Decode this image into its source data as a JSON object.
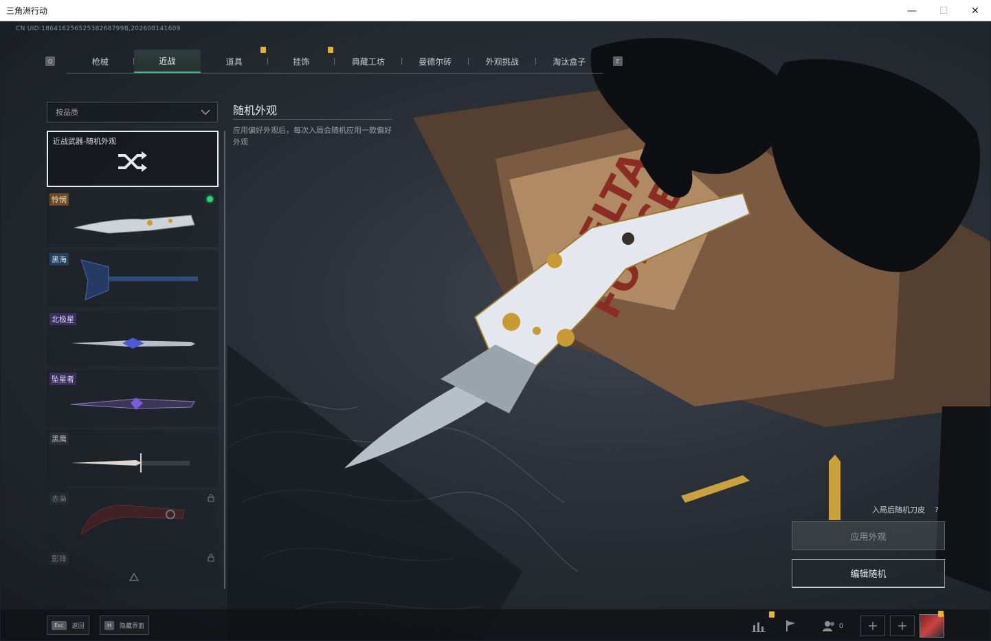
{
  "window": {
    "title": "三角洲行动",
    "minimize": "—",
    "maximize": "☐",
    "close": "✕"
  },
  "uid": "CN UID:18641625652538268799B,202608141609",
  "tabs": {
    "prev_key": "Q",
    "next_key": "E",
    "items": [
      {
        "label": "枪械",
        "active": false,
        "badge": false
      },
      {
        "label": "近战",
        "active": true,
        "badge": false
      },
      {
        "label": "道具",
        "active": false,
        "badge": true
      },
      {
        "label": "挂饰",
        "active": false,
        "badge": true
      },
      {
        "label": "典藏工坊",
        "active": false,
        "badge": false
      },
      {
        "label": "曼德尔砖",
        "active": false,
        "badge": false
      },
      {
        "label": "外观挑战",
        "active": false,
        "badge": false
      },
      {
        "label": "淘汰盒子",
        "active": false,
        "badge": false
      }
    ]
  },
  "sort": {
    "label": "按品质"
  },
  "list": {
    "items": [
      {
        "name": "近战武器-随机外观",
        "quality": "none",
        "selected": true,
        "equipped": false,
        "locked": false,
        "icon": "shuffle-icon"
      },
      {
        "name": "怜悯",
        "quality": "orange",
        "selected": false,
        "equipped": true,
        "locked": false,
        "icon": "butterfly-knife-icon"
      },
      {
        "name": "黑海",
        "quality": "blue",
        "selected": false,
        "equipped": false,
        "locked": false,
        "icon": "tomahawk-icon"
      },
      {
        "name": "北极星",
        "quality": "purple",
        "selected": false,
        "equipped": false,
        "locked": false,
        "icon": "dagger-icon"
      },
      {
        "name": "坠星者",
        "quality": "purple",
        "selected": false,
        "equipped": false,
        "locked": false,
        "icon": "blade-icon"
      },
      {
        "name": "黑鹰",
        "quality": "gray",
        "selected": false,
        "equipped": false,
        "locked": false,
        "icon": "combat-knife-icon"
      },
      {
        "name": "赤枭",
        "quality": "gray",
        "selected": false,
        "equipped": false,
        "locked": true,
        "icon": "karambit-icon"
      },
      {
        "name": "影锋",
        "quality": "gray",
        "selected": false,
        "equipped": false,
        "locked": true,
        "icon": "blade-icon"
      }
    ]
  },
  "info": {
    "title": "随机外观",
    "description": "应用偏好外观后，每次入局会随机应用一款偏好外观"
  },
  "controls": {
    "random_label": "入局后随机刀皮",
    "help": "?",
    "apply_button": "应用外观",
    "edit_button": "编辑随机"
  },
  "bottom": {
    "back_key": "Esc",
    "back_label": "返回",
    "hide_key": "H",
    "hide_label": "隐藏界面",
    "friend_count": "0"
  },
  "colors": {
    "accent_green": "#3fb78a",
    "equipped_dot": "#27d86b",
    "badge_yellow": "#e7b428"
  }
}
